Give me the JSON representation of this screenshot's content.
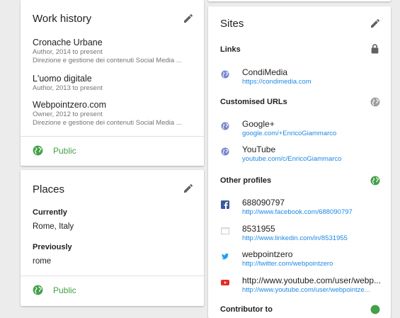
{
  "work_history": {
    "title": "Work history",
    "entries": [
      {
        "title": "Cronache Urbane",
        "sub1": "Author, 2014 to present",
        "sub2": "Direzione e gestione dei contenuti Social Media ..."
      },
      {
        "title": "L'uomo digitale",
        "sub1": "Author, 2013 to present"
      },
      {
        "title": "Webpointzero.com",
        "sub1": "Owner, 2012 to present",
        "sub2": "Direzione e gestione dei contenuti Social Media ..."
      }
    ],
    "visibility": "Public"
  },
  "places": {
    "title": "Places",
    "currently_label": "Currently",
    "currently_value": "Rome, Italy",
    "previously_label": "Previously",
    "previously_value": "rome",
    "visibility": "Public"
  },
  "sites": {
    "title": "Sites",
    "links_label": "Links",
    "links": [
      {
        "name": "CondiMedia",
        "url": "https://condimedia.com",
        "icon": "globe-icon"
      }
    ],
    "custom_label": "Customised URLs",
    "custom": [
      {
        "name": "Google+",
        "url": "google.com/+EnricoGiammarco",
        "icon": "globe-icon"
      },
      {
        "name": "YouTube",
        "url": "youtube.com/c/EnricoGiammarco",
        "icon": "globe-icon"
      }
    ],
    "other_label": "Other profiles",
    "other": [
      {
        "name": "688090797",
        "url": "http://www.facebook.com/688090797",
        "icon": "facebook-icon"
      },
      {
        "name": "8531955",
        "url": "http://www.linkedin.com/in/8531955",
        "icon": "generic-site-icon"
      },
      {
        "name": "webpointzero",
        "url": "http://twitter.com/webpointzero",
        "icon": "twitter-icon"
      },
      {
        "name": "http://www.youtube.com/user/webp...",
        "url": "http://www.youtube.com/user/webpointze...",
        "icon": "youtube-icon"
      }
    ],
    "next_label": "Contributor to"
  },
  "colors": {
    "public_green": "#43a047",
    "link_blue": "#1e88e5",
    "accent_blue": "#7986cb"
  }
}
